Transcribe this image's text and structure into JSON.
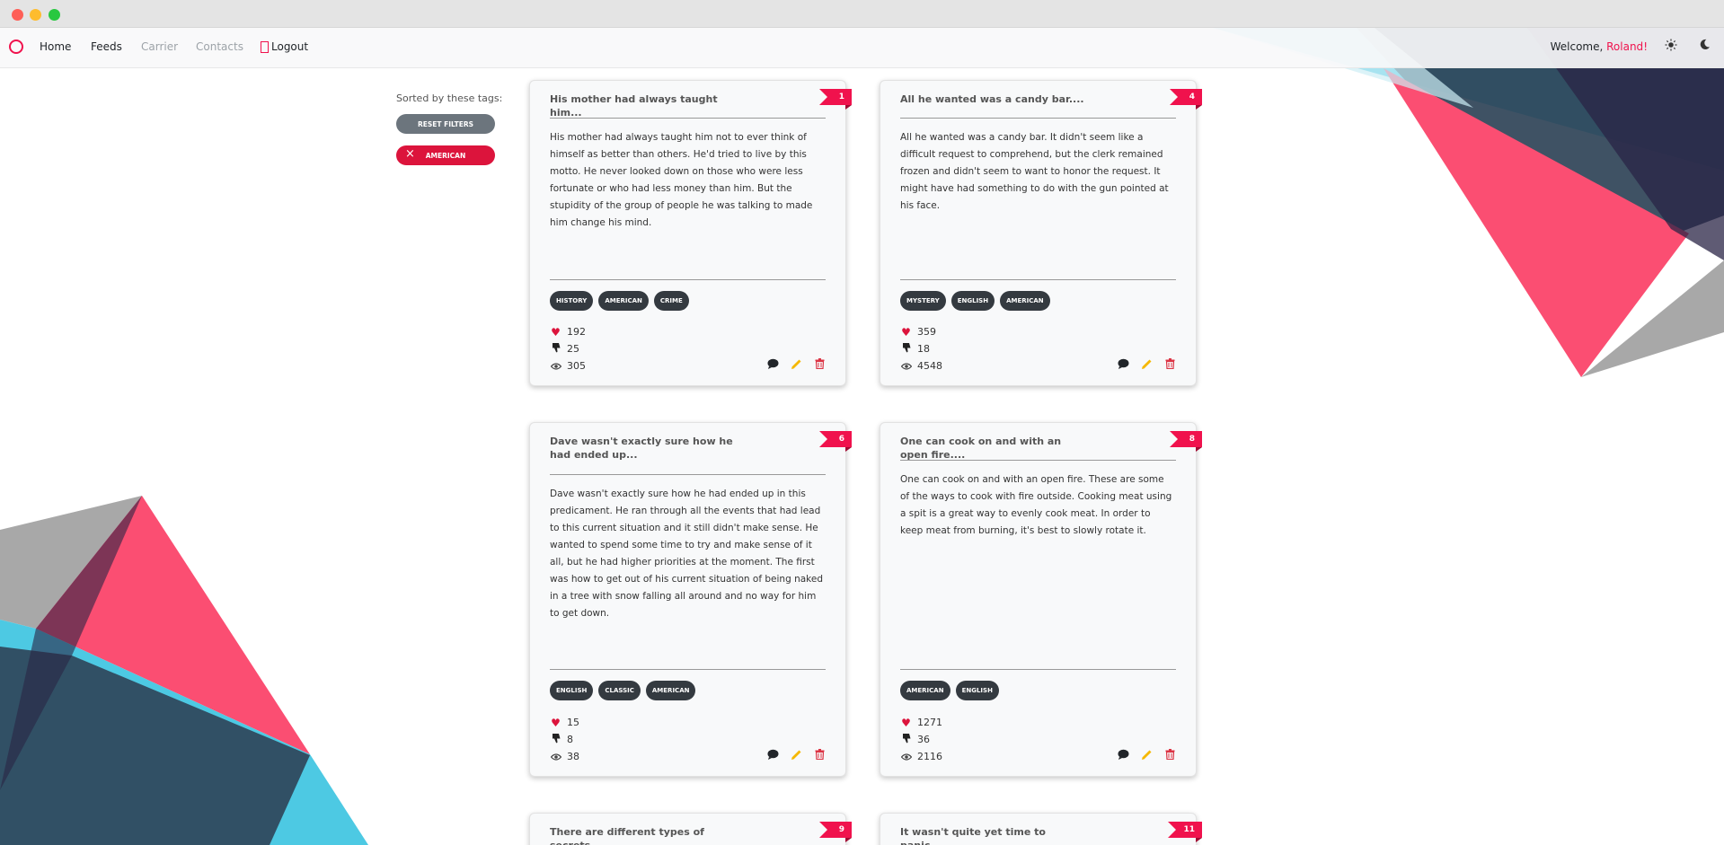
{
  "navbar": {
    "links": [
      "Home",
      "Feeds",
      "Carrier",
      "Contacts",
      "Logout"
    ],
    "welcome_prefix": "Welcome, ",
    "user_name": "Roland",
    "welcome_suffix": "!"
  },
  "sidebar": {
    "sorted_label": "Sorted by these tags:",
    "reset_label": "RESET FILTERS",
    "active_tag": "AMERICAN"
  },
  "colors": {
    "accent": "#f0124d",
    "tag_bg": "#343a40",
    "reset_bg": "#6c757d"
  },
  "cards": [
    {
      "id": "1",
      "title": "His mother had always taught him...",
      "text": "His mother had always taught him not to ever think of himself as better than others. He'd tried to live by this motto. He never looked down on those who were less fortunate or who had less money than him. But the stupidity of the group of people he was talking to made him change his mind.",
      "tags": [
        "HISTORY",
        "AMERICAN",
        "CRIME"
      ],
      "likes": "192",
      "dislikes": "25",
      "views": "305"
    },
    {
      "id": "4",
      "title": "All he wanted was a candy bar....",
      "text": "All he wanted was a candy bar. It didn't seem like a difficult request to comprehend, but the clerk remained frozen and didn't seem to want to honor the request. It might have had something to do with the gun pointed at his face.",
      "tags": [
        "MYSTERY",
        "ENGLISH",
        "AMERICAN"
      ],
      "likes": "359",
      "dislikes": "18",
      "views": "4548"
    },
    {
      "id": "6",
      "title": "Dave wasn't exactly sure how he had ended up...",
      "text": "Dave wasn't exactly sure how he had ended up in this predicament. He ran through all the events that had lead to this current situation and it still didn't make sense. He wanted to spend some time to try and make sense of it all, but he had higher priorities at the moment. The first was how to get out of his current situation of being naked in a tree with snow falling all around and no way for him to get down.",
      "tags": [
        "ENGLISH",
        "CLASSIC",
        "AMERICAN"
      ],
      "likes": "15",
      "dislikes": "8",
      "views": "38"
    },
    {
      "id": "8",
      "title": "One can cook on and with an open fire....",
      "text": "One can cook on and with an open fire. These are some of the ways to cook with fire outside. Cooking meat using a spit is a great way to evenly cook meat. In order to keep meat from burning, it's best to slowly rotate it.",
      "tags": [
        "AMERICAN",
        "ENGLISH"
      ],
      "likes": "1271",
      "dislikes": "36",
      "views": "2116"
    },
    {
      "id": "9",
      "title": "There are different types of secrets...."
    },
    {
      "id": "11",
      "title": "It wasn't quite yet time to panic...."
    }
  ]
}
